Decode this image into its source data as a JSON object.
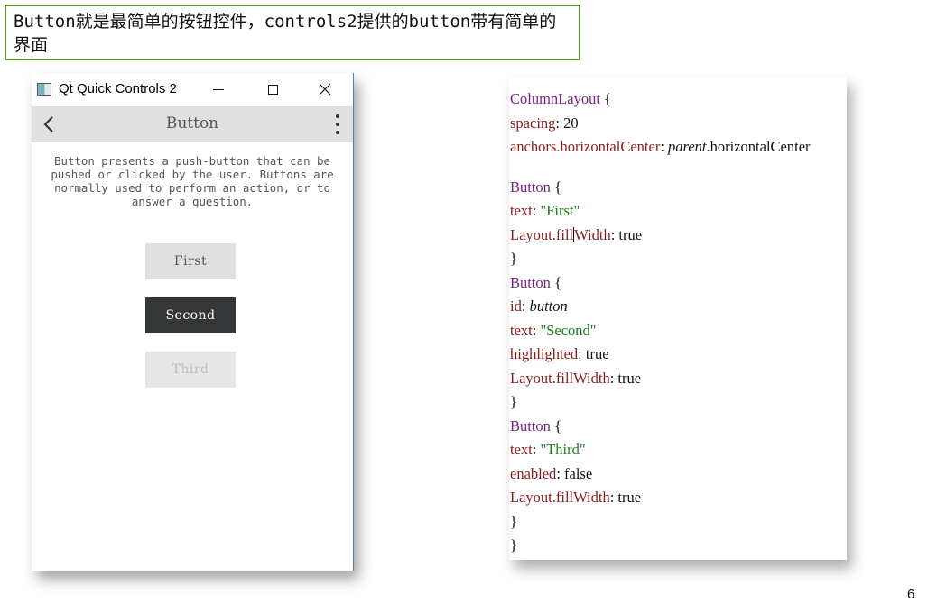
{
  "slide": {
    "heading": "Button就是最简单的按钮控件，controls2提供的button带有简单的界面",
    "page_number": "6"
  },
  "window": {
    "title": "Qt Quick Controls 2",
    "toolbar_title": "Button",
    "description": "Button presents a push-button that can be pushed or clicked by the user. Buttons are normally used to perform an action, or to answer a question.",
    "buttons": [
      {
        "label": "First",
        "state": "normal"
      },
      {
        "label": "Second",
        "state": "highlighted"
      },
      {
        "label": "Third",
        "state": "disabled"
      }
    ]
  },
  "code": {
    "l0": {
      "a": "ColumnLayout",
      "b": " {"
    },
    "l1": {
      "a": "spacing",
      "b": ": 20"
    },
    "l2": {
      "a": "anchors.horizontalCenter",
      "b": ": ",
      "c": "parent",
      "d": ".horizontalCenter"
    },
    "l3": {
      "a": "Button",
      "b": " {"
    },
    "l4": {
      "a": "text",
      "b": ": ",
      "c": "\"First\""
    },
    "l5": {
      "a": "Layout.fill",
      "b": "Width",
      "c": ": true"
    },
    "l6": {
      "a": "}"
    },
    "l7": {
      "a": "Button",
      "b": " {"
    },
    "l8": {
      "a": "id",
      "b": ": ",
      "c": "button"
    },
    "l9": {
      "a": "text",
      "b": ": ",
      "c": "\"Second\""
    },
    "l10": {
      "a": "highlighted",
      "b": ": true"
    },
    "l11": {
      "a": "Layout.fillWidth",
      "b": ": true"
    },
    "l12": {
      "a": "}"
    },
    "l13": {
      "a": "Button",
      "b": " {"
    },
    "l14": {
      "a": "text",
      "b": ": ",
      "c": "\"Third\""
    },
    "l15": {
      "a": "enabled",
      "b": ": false"
    },
    "l16": {
      "a": "Layout.fillWidth",
      "b": ": true"
    },
    "l17": {
      "a": "}"
    },
    "l18": {
      "a": "}"
    }
  },
  "icons": {
    "app": "qt-app-icon",
    "minimize": "minimize-icon",
    "maximize": "maximize-icon",
    "close": "close-icon",
    "back": "back-arrow-icon",
    "menu": "more-vert-icon"
  },
  "colors": {
    "heading_border": "#5e8a32",
    "toolbar_bg": "#e0e0e0",
    "button_default": "#e0e0e0",
    "button_highlighted": "#353637",
    "code_keyword": "#7b1f86",
    "code_property": "#8a1b1b",
    "code_string": "#1e7d1e"
  }
}
